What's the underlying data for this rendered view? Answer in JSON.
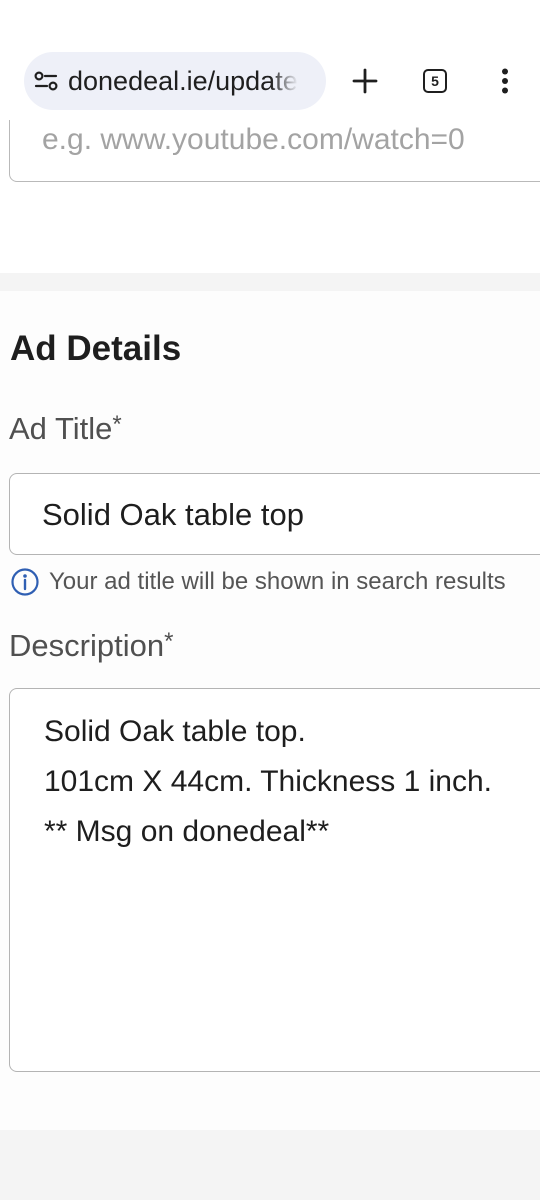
{
  "browser": {
    "url": "donedeal.ie/update",
    "tab_count": "5",
    "icons": {
      "site_info": "site-settings-icon",
      "new_tab": "plus-icon",
      "tabs": "tab-switcher-icon",
      "menu": "more-vert-icon"
    }
  },
  "video": {
    "placeholder": "e.g. www.youtube.com/watch=0"
  },
  "ad_details": {
    "section_title": "Ad Details",
    "title_label": "Ad Title",
    "required_marker": "*",
    "title_value": "Solid Oak table top",
    "title_hint": "Your ad title will be shown in search results",
    "description_label": "Description",
    "description_lines": [
      "Solid Oak table top.",
      "101cm X 44cm. Thickness 1 inch.",
      "** Msg on donedeal**"
    ]
  },
  "colors": {
    "hint_icon": "#2f5fb3",
    "url_pill": "#eef0f8",
    "section_band": "#f4f4f4"
  }
}
